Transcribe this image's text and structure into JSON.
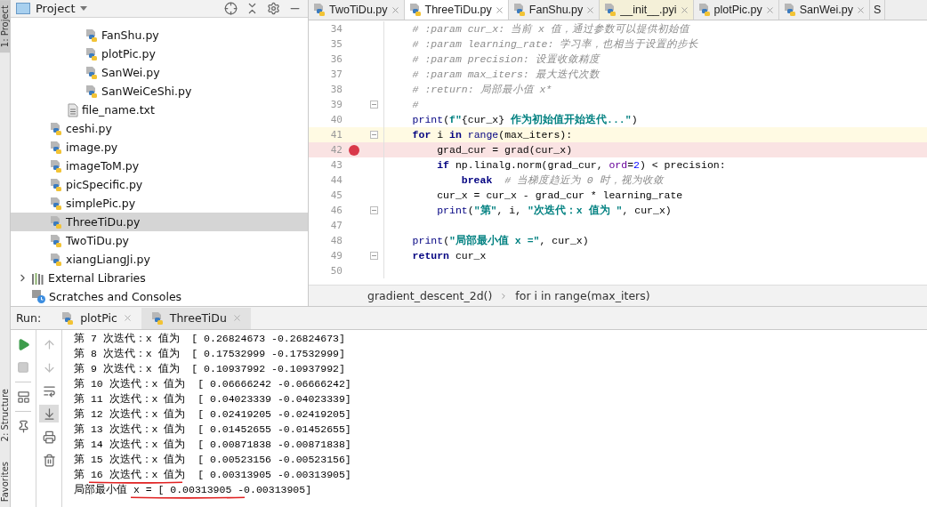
{
  "side_tabs": [
    {
      "label": "1: Project",
      "selected": true
    },
    {
      "label": "2: Structure",
      "selected": false
    },
    {
      "label": "Favorites",
      "selected": false
    }
  ],
  "project": {
    "title": "Project",
    "tree": [
      {
        "children": [
          {
            "children": [
              {
                "children": [
                  {
                    "label": "FanShu.py",
                    "kind": "python",
                    "selected": false
                  },
                  {
                    "label": "plotPic.py",
                    "kind": "python",
                    "selected": false
                  },
                  {
                    "label": "SanWei.py",
                    "kind": "python",
                    "selected": false
                  },
                  {
                    "label": "SanWeiCeShi.py",
                    "kind": "python",
                    "selected": false
                  }
                ]
              },
              {
                "label": "file_name.txt",
                "kind": "text",
                "selected": false
              }
            ]
          },
          {
            "label": "ceshi.py",
            "kind": "python",
            "selected": false
          },
          {
            "label": "image.py",
            "kind": "python",
            "selected": false
          },
          {
            "label": "imageToM.py",
            "kind": "python",
            "selected": false
          },
          {
            "label": "picSpecific.py",
            "kind": "python",
            "selected": false
          },
          {
            "label": "simplePic.py",
            "kind": "python",
            "selected": false
          },
          {
            "label": "ThreeTiDu.py",
            "kind": "python",
            "selected": true
          },
          {
            "label": "TwoTiDu.py",
            "kind": "python",
            "selected": false
          },
          {
            "label": "xiangLiangJi.py",
            "kind": "python",
            "selected": false
          }
        ]
      },
      {
        "label": "External Libraries",
        "kind": "libraries",
        "expanded": false,
        "selected": false
      },
      {
        "label": "Scratches and Consoles",
        "kind": "scratches",
        "selected": false
      }
    ]
  },
  "editor": {
    "tabs": [
      {
        "label": "TwoTiDu.py",
        "kind": "python",
        "selected": false
      },
      {
        "label": "ThreeTiDu.py",
        "kind": "python",
        "selected": true
      },
      {
        "label": "FanShu.py",
        "kind": "python",
        "selected": false
      },
      {
        "label": "__init__.pyi",
        "kind": "library",
        "selected": false
      },
      {
        "label": "plotPic.py",
        "kind": "python",
        "selected": false
      },
      {
        "label": "SanWei.py",
        "kind": "python",
        "selected": false
      },
      {
        "label": "S",
        "kind": "cut",
        "selected": false
      }
    ],
    "lines": [
      {
        "number": "34",
        "fold": false,
        "breakpoint": false,
        "current": false,
        "tokens": [
          {
            "text": "    # :param cur_x: 当前 x 值，通过参数可以提供初始值",
            "kind": "comment"
          }
        ]
      },
      {
        "number": "35",
        "fold": false,
        "breakpoint": false,
        "current": false,
        "tokens": [
          {
            "text": "    # :param learning_rate: 学习率，也相当于设置的步长",
            "kind": "comment"
          }
        ]
      },
      {
        "number": "36",
        "fold": false,
        "breakpoint": false,
        "current": false,
        "tokens": [
          {
            "text": "    # :param precision: 设置收敛精度",
            "kind": "comment"
          }
        ]
      },
      {
        "number": "37",
        "fold": false,
        "breakpoint": false,
        "current": false,
        "tokens": [
          {
            "text": "    # :param max_iters: 最大迭代次数",
            "kind": "comment"
          }
        ]
      },
      {
        "number": "38",
        "fold": false,
        "breakpoint": false,
        "current": false,
        "tokens": [
          {
            "text": "    # :return: 局部最小值 x*",
            "kind": "comment"
          }
        ]
      },
      {
        "number": "39",
        "fold": true,
        "breakpoint": false,
        "current": false,
        "tokens": [
          {
            "text": "    #",
            "kind": "comment"
          }
        ]
      },
      {
        "number": "40",
        "fold": false,
        "breakpoint": false,
        "current": false,
        "tokens": [
          {
            "text": "    print",
            "kind": "builtin"
          },
          {
            "text": "(",
            "kind": "plain"
          },
          {
            "text": "f\"",
            "kind": "string"
          },
          {
            "text": "{cur_x}",
            "kind": "plain"
          },
          {
            "text": " 作为初始值开始迭代...\"",
            "kind": "string"
          },
          {
            "text": ")",
            "kind": "plain"
          }
        ]
      },
      {
        "number": "41",
        "fold": true,
        "breakpoint": false,
        "current": true,
        "tokens": [
          {
            "text": "    for",
            "kind": "keyword"
          },
          {
            "text": " i ",
            "kind": "plain"
          },
          {
            "text": "in",
            "kind": "keyword"
          },
          {
            "text": " range",
            "kind": "builtin"
          },
          {
            "text": "(max_iters):",
            "kind": "plain"
          }
        ]
      },
      {
        "number": "42",
        "fold": false,
        "breakpoint": true,
        "current": false,
        "tokens": [
          {
            "text": "        grad_cur = grad(cur_x)",
            "kind": "plain"
          }
        ]
      },
      {
        "number": "43",
        "fold": false,
        "breakpoint": false,
        "current": false,
        "tokens": [
          {
            "text": "        if",
            "kind": "keyword"
          },
          {
            "text": " np.linalg.norm(grad_cur, ",
            "kind": "plain"
          },
          {
            "text": "ord",
            "kind": "param"
          },
          {
            "text": "=",
            "kind": "plain"
          },
          {
            "text": "2",
            "kind": "number"
          },
          {
            "text": ") < precision:",
            "kind": "plain"
          }
        ]
      },
      {
        "number": "44",
        "fold": false,
        "breakpoint": false,
        "current": false,
        "tokens": [
          {
            "text": "            break",
            "kind": "keyword"
          },
          {
            "text": "  # 当梯度趋近为 0 时，视为收敛",
            "kind": "comment"
          }
        ]
      },
      {
        "number": "45",
        "fold": false,
        "breakpoint": false,
        "current": false,
        "tokens": [
          {
            "text": "        cur_x = cur_x - grad_cur * learning_rate",
            "kind": "plain"
          }
        ]
      },
      {
        "number": "46",
        "fold": true,
        "breakpoint": false,
        "current": false,
        "tokens": [
          {
            "text": "        print",
            "kind": "builtin"
          },
          {
            "text": "(",
            "kind": "plain"
          },
          {
            "text": "\"第\"",
            "kind": "string"
          },
          {
            "text": ", i, ",
            "kind": "plain"
          },
          {
            "text": "\"次迭代：x 值为 \"",
            "kind": "string"
          },
          {
            "text": ", cur_x)",
            "kind": "plain"
          }
        ]
      },
      {
        "number": "47",
        "fold": false,
        "breakpoint": false,
        "current": false
      },
      {
        "number": "48",
        "fold": false,
        "breakpoint": false,
        "current": false,
        "tokens": [
          {
            "text": "    print",
            "kind": "builtin"
          },
          {
            "text": "(",
            "kind": "plain"
          },
          {
            "text": "\"局部最小值 x =\"",
            "kind": "string"
          },
          {
            "text": ", cur_x)",
            "kind": "plain"
          }
        ]
      },
      {
        "number": "49",
        "fold": true,
        "breakpoint": false,
        "current": false,
        "tokens": [
          {
            "text": "    return",
            "kind": "keyword"
          },
          {
            "text": " cur_x",
            "kind": "plain"
          }
        ]
      },
      {
        "number": "50",
        "fold": false,
        "breakpoint": false,
        "current": false
      }
    ],
    "breadcrumbs": [
      "gradient_descent_2d()",
      "for i in range(max_iters)"
    ]
  },
  "run": {
    "label": "Run:",
    "tabs": [
      {
        "label": "plotPic",
        "selected": false
      },
      {
        "label": "ThreeTiDu",
        "selected": true
      }
    ],
    "scroll_to_end": true,
    "output": [
      "第 7 次迭代：x 值为  [ 0.26824673 -0.26824673]",
      "第 8 次迭代：x 值为  [ 0.17532999 -0.17532999]",
      "第 9 次迭代：x 值为  [ 0.10937992 -0.10937992]",
      "第 10 次迭代：x 值为  [ 0.06666242 -0.06666242]",
      "第 11 次迭代：x 值为  [ 0.04023339 -0.04023339]",
      "第 12 次迭代：x 值为  [ 0.02419205 -0.02419205]",
      "第 13 次迭代：x 值为  [ 0.01452655 -0.01452655]",
      "第 14 次迭代：x 值为  [ 0.00871838 -0.00871838]",
      "第 15 次迭代：x 值为  [ 0.00523156 -0.00523156]",
      "第 16 次迭代：x 值为  [ 0.00313905 -0.00313905]",
      "局部最小值 x = [ 0.00313905 -0.00313905]"
    ]
  }
}
